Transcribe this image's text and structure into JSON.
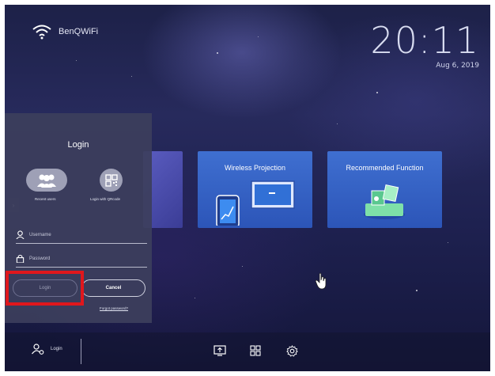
{
  "status": {
    "network_name": "BenQWiFi",
    "time": "20:11",
    "date": "Aug 6, 2019"
  },
  "tiles": [
    {
      "title": "Wireless Projection"
    },
    {
      "title": "Recommended Function"
    }
  ],
  "login_panel": {
    "title": "Login",
    "recent_users_label": "Recent users",
    "qr_label": "Login with QRcode",
    "username_placeholder": "Username",
    "password_placeholder": "Password",
    "login_button": "Login",
    "cancel_button": "Cancel",
    "forgot_link": "Forgot password?"
  },
  "bottom_bar": {
    "login_label": "Login"
  },
  "colors": {
    "highlight": "#e0171c",
    "tile": "#3465c8",
    "panel": "#3c3e5c"
  },
  "icons": [
    "wifi-icon",
    "group-icon",
    "qr-code-icon",
    "user-icon",
    "lock-icon",
    "chevron-right-icon",
    "hand-pointer-icon",
    "user-settings-icon",
    "screen-share-icon",
    "apps-grid-icon",
    "gear-icon"
  ]
}
